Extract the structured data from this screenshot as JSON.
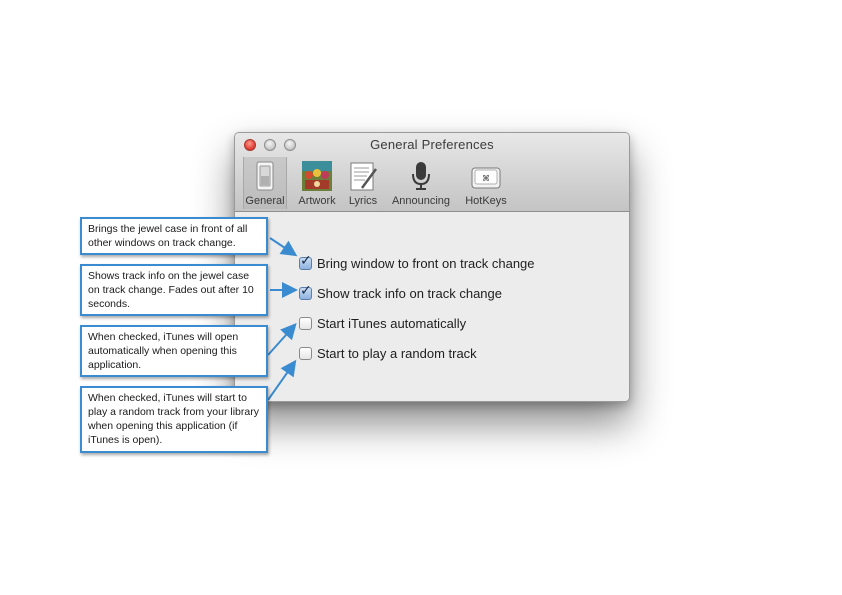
{
  "window": {
    "title": "General Preferences",
    "tabs": [
      {
        "label": "General",
        "icon": "switch-icon",
        "selected": true
      },
      {
        "label": "Artwork",
        "icon": "album-artwork-icon",
        "selected": false
      },
      {
        "label": "Lyrics",
        "icon": "lyrics-paper-icon",
        "selected": false
      },
      {
        "label": "Announcing",
        "icon": "microphone-icon",
        "selected": false
      },
      {
        "label": "HotKeys",
        "icon": "keyboard-key-icon",
        "selected": false
      }
    ],
    "options": [
      {
        "label": "Bring window to front on track change",
        "checked": true
      },
      {
        "label": "Show track info on track change",
        "checked": true
      },
      {
        "label": "Start iTunes automatically",
        "checked": false
      },
      {
        "label": "Start to play a random track",
        "checked": false
      }
    ]
  },
  "callouts": [
    "Brings the jewel case in front of all other windows on track change.",
    "Shows track info on the jewel case on track change. Fades out after 10 seconds.",
    "When checked, iTunes will open automatically when opening this application.",
    "When checked, iTunes will start to play a random track from your library when opening this application (if iTunes is open)."
  ],
  "colors": {
    "callout_border": "#3a8bd0",
    "checkbox_checked": "#8fb3e0",
    "close_button": "#e0463a"
  }
}
